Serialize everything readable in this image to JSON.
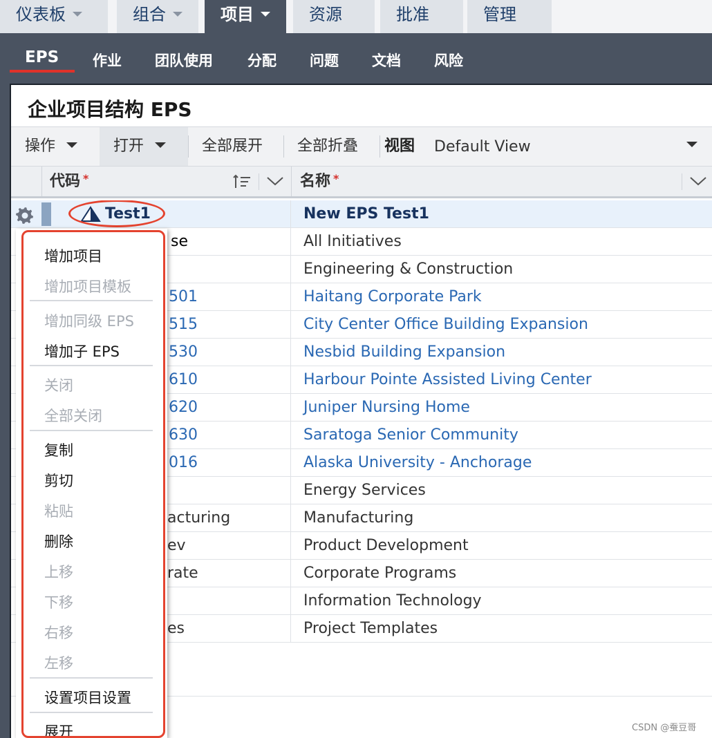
{
  "top_tabs": [
    {
      "label": "仪表板",
      "active": false
    },
    {
      "label": "组合",
      "active": false
    },
    {
      "label": "项目",
      "active": true
    },
    {
      "label": "资源",
      "active": false
    },
    {
      "label": "批准",
      "active": false
    },
    {
      "label": "管理",
      "active": false
    }
  ],
  "sub_nav": [
    "EPS",
    "作业",
    "团队使用",
    "分配",
    "问题",
    "文档",
    "风险"
  ],
  "panel": {
    "title": "企业项目结构 EPS",
    "toolbar": {
      "actions_label": "操作",
      "open_label": "打开",
      "expand_all_label": "全部展开",
      "collapse_all_label": "全部折叠",
      "view_label": "视图",
      "view_value": "Default View"
    },
    "columns": {
      "code": "代码",
      "name": "名称",
      "required_mark": "*"
    }
  },
  "rows": [
    {
      "code": "Test1",
      "name": "New EPS Test1",
      "selected": true,
      "link": false
    },
    {
      "code": "se",
      "name": "All Initiatives",
      "link": false
    },
    {
      "code": "",
      "name": "Engineering & Construction",
      "link": false
    },
    {
      "code": "501",
      "name": "Haitang Corporate Park",
      "link": true
    },
    {
      "code": "515",
      "name": "City Center Office Building Expansion",
      "link": true
    },
    {
      "code": "530",
      "name": "Nesbid Building Expansion",
      "link": true
    },
    {
      "code": "610",
      "name": "Harbour Pointe Assisted Living Center",
      "link": true
    },
    {
      "code": "620",
      "name": "Juniper Nursing Home",
      "link": true
    },
    {
      "code": "630",
      "name": "Saratoga Senior Community",
      "link": true
    },
    {
      "code": "016",
      "name": "Alaska University - Anchorage",
      "link": true
    },
    {
      "code": "",
      "name": "Energy Services",
      "link": false
    },
    {
      "code": "acturing",
      "name": "Manufacturing",
      "link": false
    },
    {
      "code": "ev",
      "name": "Product Development",
      "link": false
    },
    {
      "code": "rate",
      "name": "Corporate Programs",
      "link": false
    },
    {
      "code": "",
      "name": "Information Technology",
      "link": false
    },
    {
      "code": "es",
      "name": "Project Templates",
      "link": false
    }
  ],
  "context_menu": [
    {
      "label": "增加项目",
      "enabled": true
    },
    {
      "label": "增加项目模板",
      "enabled": false
    },
    {
      "label": "增加同级 EPS",
      "enabled": false
    },
    {
      "label": "增加子 EPS",
      "enabled": true
    },
    {
      "label": "关闭",
      "enabled": false
    },
    {
      "label": "全部关闭",
      "enabled": false
    },
    {
      "label": "复制",
      "enabled": true
    },
    {
      "label": "剪切",
      "enabled": true
    },
    {
      "label": "粘贴",
      "enabled": false
    },
    {
      "label": "删除",
      "enabled": true
    },
    {
      "label": "上移",
      "enabled": false
    },
    {
      "label": "下移",
      "enabled": false
    },
    {
      "label": "右移",
      "enabled": false
    },
    {
      "label": "左移",
      "enabled": false
    },
    {
      "label": "设置项目设置",
      "enabled": true
    },
    {
      "label": "展开",
      "enabled": true
    }
  ],
  "watermark": "CSDN @蚕豆哥",
  "colors": {
    "accent_red": "#e4432f",
    "nav_bg": "#4a5361",
    "link_blue": "#2a68b3"
  }
}
